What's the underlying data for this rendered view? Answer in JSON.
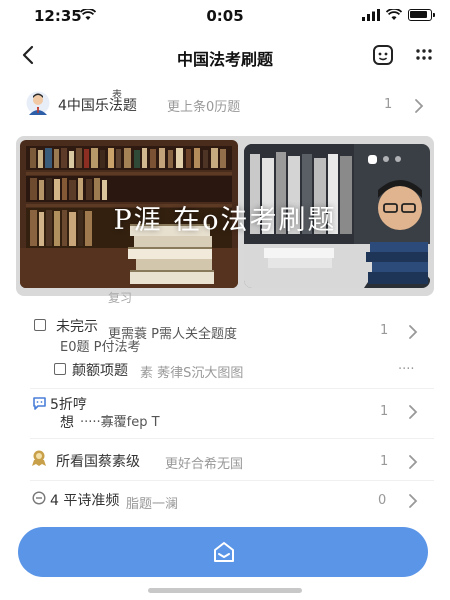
{
  "status_bar": {
    "time_left": "12:35",
    "time_center": "0:05"
  },
  "nav": {
    "title": "中国法考刷题"
  },
  "profile": {
    "name": "4中国乐法题",
    "superscript": "表",
    "subtitle": "更上条0历题",
    "count": "1"
  },
  "banner": {
    "text": "P涯 在o法考刷题",
    "caption": "复习"
  },
  "list": [
    {
      "title": "未完示",
      "sub": "更需蓑  P需人关全题度",
      "count": "1"
    },
    {
      "title": "E0题 P付法考",
      "sub": ""
    },
    {
      "title": "颠额项题",
      "sub": "素 莠律S沉大图图",
      "count": "...."
    },
    {
      "title": "5折哼",
      "title2": "想",
      "sub": "·····寡覆fep T",
      "count": "1"
    },
    {
      "title": "所看国蔡素级",
      "sub": "更好合希无国",
      "count": "1"
    },
    {
      "title": "4 平诗准频",
      "sub": "脂题一澜",
      "count": "0"
    }
  ],
  "colors": {
    "accent": "#5b95e8",
    "icon_blue": "#4a7fd8",
    "icon_gold": "#c8a04a"
  },
  "icons": [
    "wifi-icon",
    "signal-icon",
    "battery-icon",
    "back-arrow-icon",
    "face-scan-icon",
    "more-icon",
    "chevron-right-icon",
    "checkbox-icon",
    "chat-icon",
    "medal-icon",
    "clock-icon",
    "home-icon"
  ]
}
